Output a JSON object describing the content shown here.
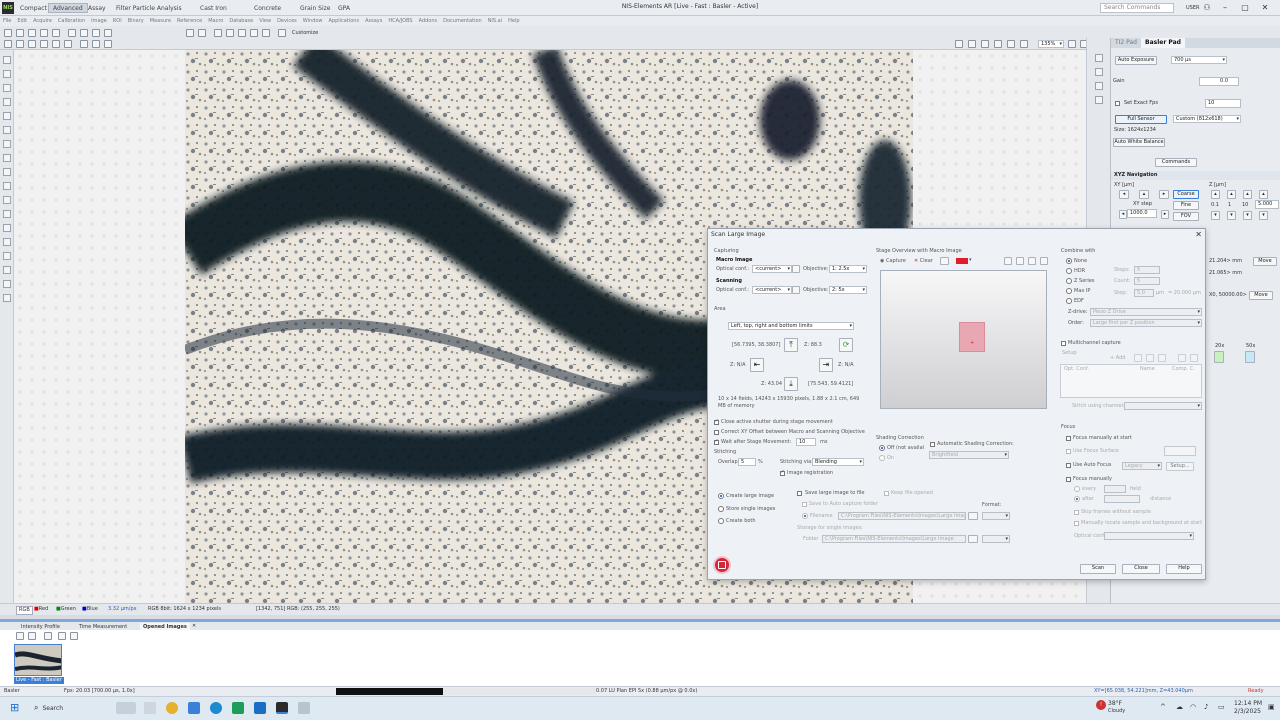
{
  "app": {
    "logo": "NIS",
    "window_title": "NIS-Elements AR  [Live - Fast : Basler - Active]",
    "search_placeholder": "Search Commands",
    "user": "USER",
    "tabs": [
      "Compact",
      "Advanced",
      "Assay",
      "Filter Particle Analysis",
      "Cast Iron",
      "Concrete",
      "Grain Size",
      "GPA"
    ],
    "menu": [
      "File",
      "Edit",
      "Acquire",
      "Calibration",
      "Image",
      "ROI",
      "Binary",
      "Measure",
      "Reference",
      "Macro",
      "Database",
      "View",
      "Devices",
      "Window",
      "Applications",
      "Assays",
      "HCA/JOBS",
      "Addons",
      "Documentation",
      "NIS.ai",
      "Help"
    ],
    "customize_label": "Customize",
    "zoom": "135%"
  },
  "basler_pad": {
    "tabs": [
      "TI2 Pad",
      "Basler Pad"
    ],
    "auto_exposure": "Auto Exposure",
    "exposure_value": "700 µs",
    "gain_label": "Gain",
    "gain_value": "0.0",
    "set_exact_fps": "Set Exact Fps",
    "fps_value": "10",
    "full_sensor": "Full Sensor",
    "custom_roi": "Custom (812x618)",
    "size_text": "Size: 1624x1234",
    "auto_white_balance": "Auto White Balance",
    "commands": "Commands"
  },
  "xyz_nav": {
    "title": "XYZ Navigation",
    "xy_label": "XY  [µm]",
    "z_label": "Z  [µm]",
    "coarse": "Coarse",
    "fine": "Fine",
    "fov": "FOV",
    "xy_step_label": "XY step",
    "xy_step_value": "1000.0",
    "z_steps": [
      "0.1",
      "1",
      "10"
    ],
    "z_step_value": "5.000",
    "pos_a": "21.204> mm",
    "pos_b": "21.065> mm",
    "pos_c": "X0, 50000.00>",
    "move": "Move",
    "objectives": [
      "20x",
      "50x"
    ]
  },
  "dialog": {
    "title": "Scan Large Image",
    "capturing": "Capturing",
    "macro_image": "Macro Image",
    "optical_conf_label": "Optical conf.:",
    "optical_conf_value": "<current>",
    "objective_label": "Objective:",
    "macro_objective": "1: 2.5x",
    "scanning": "Scanning",
    "scan_objective": "2: 5x",
    "area": "Area",
    "area_mode": "Left, top, right and bottom limits",
    "top_left": "[56.7395, 38.3807]",
    "z_top": "Z: 88.3",
    "z_left": "Z: N/A",
    "z_right": "Z: N/A",
    "z_bottom": "Z: 43.04",
    "bottom_right": "[75.543, 59.4121]",
    "fields_info": "10 x 14 fields, 14243 x 15930 pixels, 1.88 x 2.1 cm, 649 MB of memory",
    "close_shutter": "Close active shutter during stage movement",
    "correct_xy": "Correct XY Offset between Macro and Scanning Objective",
    "wait_after": "Wait after Stage Movement:",
    "wait_value": "10",
    "wait_unit": "ms",
    "stitching": "Stitching",
    "overlap_label": "Overlap:",
    "overlap_value": "5",
    "overlap_unit": "%",
    "stitching_via_label": "Stitching via:",
    "stitching_via_value": "Blending",
    "image_registration": "Image registration",
    "create_large": "Create large image",
    "store_single": "Store single images",
    "create_both": "Create both",
    "save_large": "Save large image to file",
    "keep_opened": "Keep file opened",
    "save_auto": "Save to Auto capture folder",
    "filename_label": "Filename",
    "filename_value": "C:\\Program Files\\NIS-Elements\\Images\\Large Image",
    "format_label": "Format:",
    "storage_label": "Storage for single images:",
    "folder_label": "Folder",
    "folder_value": "C:\\Program Files\\NIS-Elements\\Images\\Large Image",
    "stage_overview": "Stage Overview with Macro Image",
    "capture": "Capture",
    "clear": "Clear",
    "shading_correction": "Shading Correction",
    "shading_off": "Off (not availal",
    "shading_on": "On",
    "auto_shading": "Automatic Shading Correction:",
    "auto_shading_value": "Brightfield",
    "combine_with": "Combine with",
    "combine_options": [
      "None",
      "HDR",
      "Z Series",
      "Max IP",
      "EDF"
    ],
    "steps_label": "Steps:",
    "steps_value": "5",
    "count_label": "Count:",
    "count_value": "5",
    "step_label": "Step:",
    "step_value": "5.0",
    "step_unit": "µm",
    "step_range": "= 20.000 µm",
    "zdrive_label": "Z-drive:",
    "zdrive_value": "Piezo Z Drive",
    "order_label": "Order:",
    "order_value": "Large first per Z position",
    "multichannel": "Multichannel capture",
    "setup": "Setup",
    "add": "Add",
    "opt_conf_col": "Opt. Conf.",
    "name_col": "Name",
    "comp_col": "Comp. C.",
    "stitch_channel": "Stitch using channel:",
    "focus": "Focus",
    "focus_start": "Focus manually at start",
    "use_focus_surface": "Use Focus Surface",
    "use_auto_focus": "Use Auto Focus",
    "legacy": "Legacy",
    "af_setup": "Setup...",
    "focus_manually": "Focus manually",
    "every_label": "every",
    "every_unit": "field",
    "after_label": "after",
    "after_unit": "distance",
    "skip_frames": "Skip frames without sample",
    "manual_sample": "Manually locate sample and background at start",
    "optical_conf2": "Optical conf.:",
    "scan": "Scan",
    "close": "Close",
    "help": "Help"
  },
  "status": {
    "channels": [
      "RGB",
      "Red",
      "Green",
      "Blue"
    ],
    "pixel_size": "3.32 µm/px",
    "bitdepth": "RGB 8bit: 1624 x 1234 pixels",
    "pixel_info": "[1342, 751] RGB: (255, 255, 255)"
  },
  "bottom": {
    "tabs": [
      "Intensity Profile",
      "Time Measurement",
      "Opened Images"
    ],
    "thumb_label": "Live - Fast : Basler"
  },
  "app_status": {
    "device": "Basler",
    "fps": "Fps: 20.03 [700.00 µs, 1.0x]",
    "objective": "0.07  LU Plan EPI 5x (0.88 µm/px @ 0.0x)",
    "xy": "XY=[65.038, 54.221]mm, Z=43.040µm",
    "ready": "Ready"
  },
  "taskbar": {
    "search": "Search",
    "weather_temp": "38°F",
    "weather_desc": "Cloudy",
    "time": "12:14 PM",
    "date": "2/3/2025"
  },
  "colors": {
    "accent": "#3d7fd6",
    "record": "#d6263b",
    "macro_region": "#e8a7b3"
  }
}
